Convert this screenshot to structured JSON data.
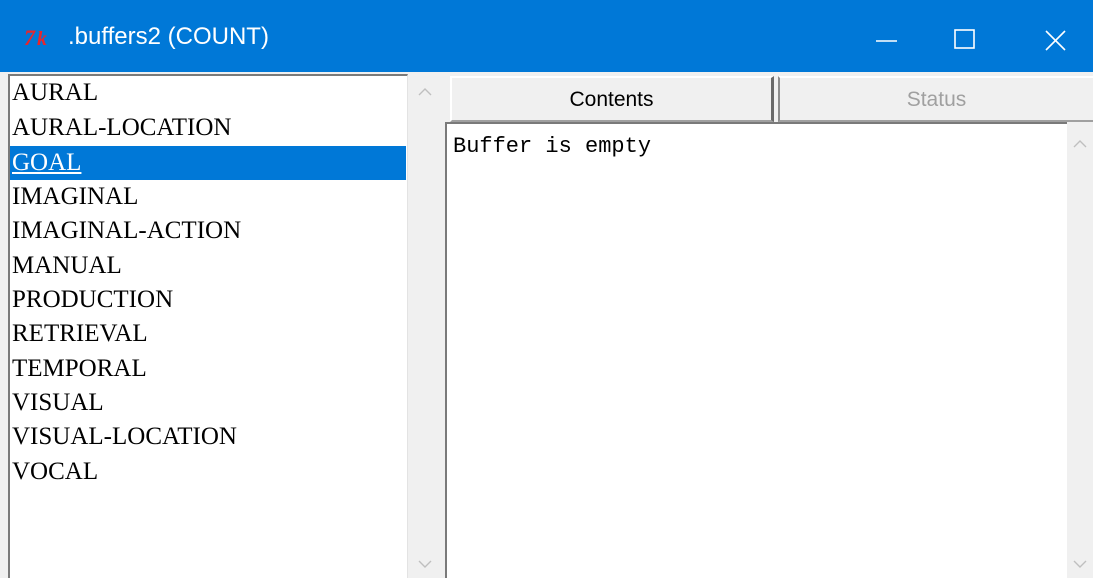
{
  "window": {
    "title": ".buffers2 (COUNT)",
    "app_icon": "tk-feather-icon",
    "accent_color": "#0078d7",
    "controls": {
      "minimize": "minimize-icon",
      "maximize": "maximize-icon",
      "close": "close-icon"
    }
  },
  "buffers": {
    "items": [
      {
        "label": "AURAL"
      },
      {
        "label": "AURAL-LOCATION"
      },
      {
        "label": "GOAL",
        "selected": true
      },
      {
        "label": "IMAGINAL"
      },
      {
        "label": "IMAGINAL-ACTION"
      },
      {
        "label": "MANUAL"
      },
      {
        "label": "PRODUCTION"
      },
      {
        "label": "RETRIEVAL"
      },
      {
        "label": "TEMPORAL"
      },
      {
        "label": "VISUAL"
      },
      {
        "label": "VISUAL-LOCATION"
      },
      {
        "label": "VOCAL"
      }
    ]
  },
  "tabs": [
    {
      "label": "Contents",
      "active": true
    },
    {
      "label": "Status",
      "active": false
    }
  ],
  "content": {
    "text": "Buffer is empty"
  }
}
